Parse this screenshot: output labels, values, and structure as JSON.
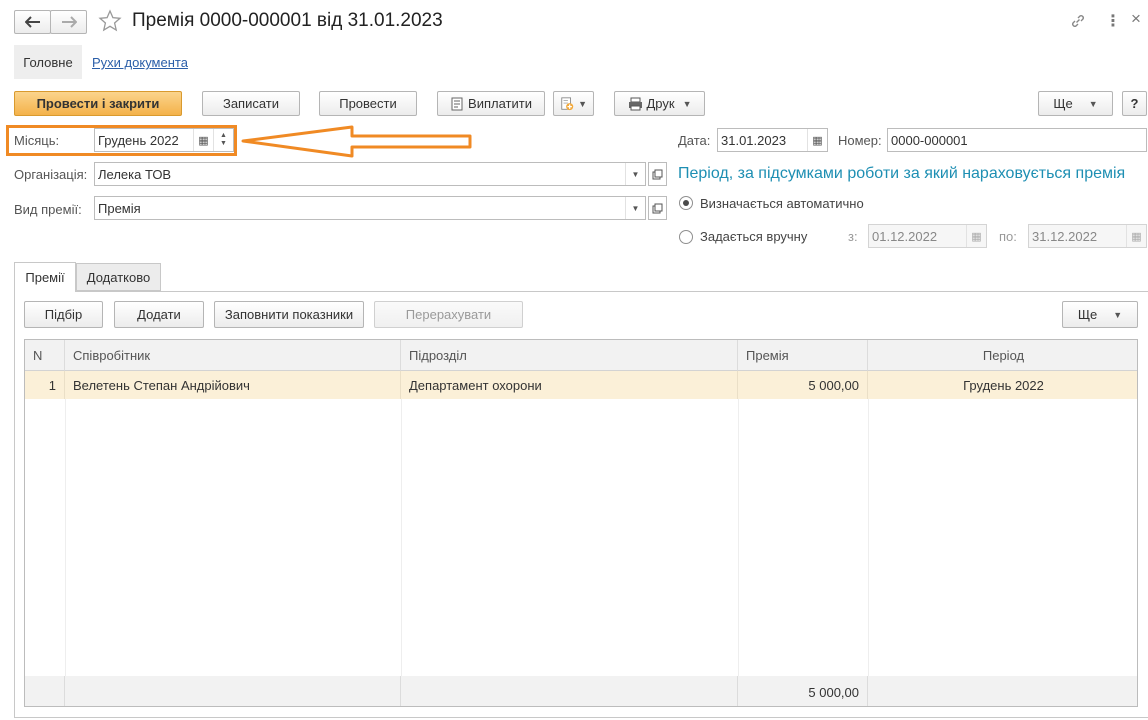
{
  "window": {
    "title": "Премія 0000-000001 від 31.01.2023",
    "more_icon": "⋮",
    "close_icon": "×"
  },
  "nav": {
    "tabs": [
      {
        "label": "Головне",
        "active": true
      },
      {
        "label": "Рухи документа",
        "active": false
      }
    ]
  },
  "toolbar": {
    "post_close": "Провести і закрити",
    "save": "Записати",
    "post": "Провести",
    "pay": "Виплатити",
    "print": "Друк",
    "more": "Ще",
    "help": "?"
  },
  "header": {
    "month_label": "Місяць:",
    "month_value": "Грудень 2022",
    "date_label": "Дата:",
    "date_value": "31.01.2023",
    "number_label": "Номер:",
    "number_value": "0000-000001",
    "org_label": "Організація:",
    "org_value": "Лелека ТОВ",
    "bonus_type_label": "Вид премії:",
    "bonus_type_value": "Премія"
  },
  "period": {
    "heading": "Період, за підсумками роботи за який нараховується премія",
    "auto_label": "Визначається автоматично",
    "manual_label": "Задається вручну",
    "selected": "auto",
    "from_label": "з:",
    "from_value": "01.12.2022",
    "to_label": "по:",
    "to_value": "31.12.2022"
  },
  "inner_tabs": [
    {
      "label": "Премії",
      "active": true
    },
    {
      "label": "Додатково",
      "active": false
    }
  ],
  "table_toolbar": {
    "pick": "Підбір",
    "add": "Додати",
    "fill": "Заповнити показники",
    "recalc": "Перерахувати",
    "more": "Ще"
  },
  "table": {
    "columns": [
      "N",
      "Співробітник",
      "Підрозділ",
      "Премія",
      "Період"
    ],
    "rows": [
      {
        "n": "1",
        "employee": "Велетень Степан Андрійович",
        "department": "Департамент охорони",
        "bonus": "5 000,00",
        "period": "Грудень 2022"
      }
    ],
    "total_bonus": "5 000,00"
  },
  "annotation": {
    "highlight_color": "#f08a24"
  },
  "colors": {
    "accent_orange": "#f4b24a",
    "link_blue": "#2a5ea8",
    "heading_teal": "#1e8fb3",
    "row_selected": "#fbf0d8"
  }
}
